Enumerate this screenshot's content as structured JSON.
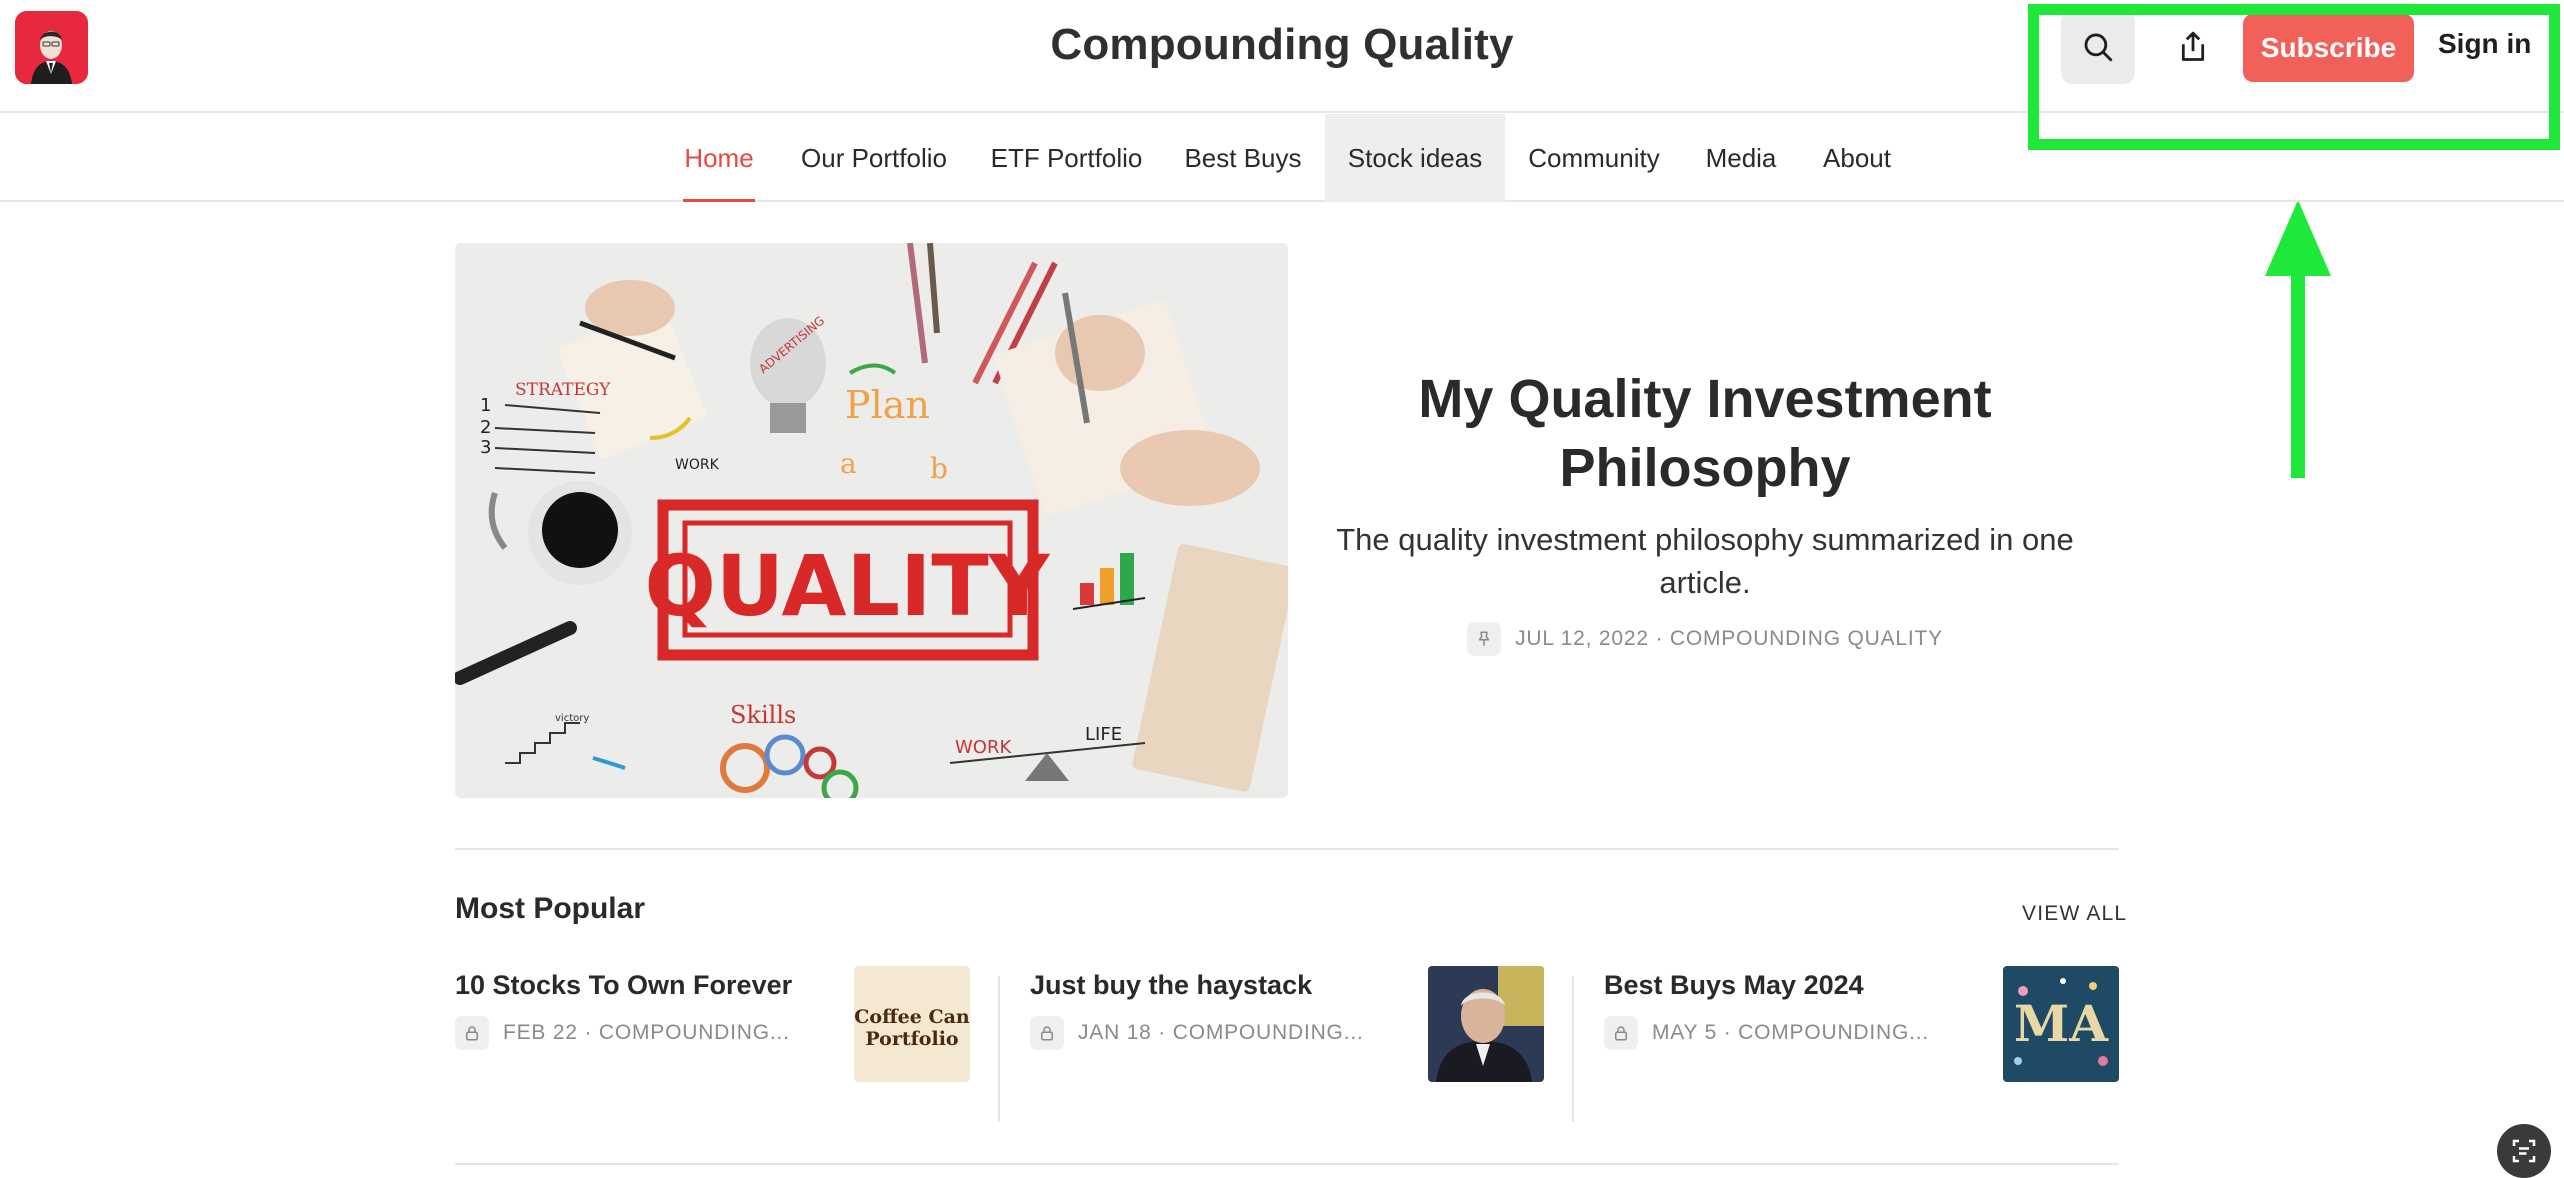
{
  "header": {
    "site_title": "Compounding Quality",
    "subscribe_label": "Subscribe",
    "signin_label": "Sign in"
  },
  "nav": {
    "items": [
      {
        "label": "Home"
      },
      {
        "label": "Our Portfolio"
      },
      {
        "label": "ETF Portfolio"
      },
      {
        "label": "Best Buys"
      },
      {
        "label": "Stock ideas"
      },
      {
        "label": "Community"
      },
      {
        "label": "Media"
      },
      {
        "label": "About"
      }
    ]
  },
  "featured": {
    "title": "My Quality Investment Philosophy",
    "subtitle": "The quality investment philosophy summarized in one article.",
    "meta": "JUL 12, 2022 · COMPOUNDING QUALITY",
    "image_words": {
      "stamp": "QUALITY",
      "strategy": "STRATEGY",
      "plan": "Plan",
      "a": "a",
      "b": "b",
      "work": "WORK",
      "skills": "Skills",
      "work2": "WORK",
      "life": "LIFE",
      "advertising": "ADVERTISING",
      "victory": "victory",
      "n1": "1",
      "n2": "2",
      "n3": "3"
    }
  },
  "most_popular": {
    "heading": "Most Popular",
    "view_all": "VIEW ALL",
    "items": [
      {
        "title": "10 Stocks To Own Forever",
        "meta": "FEB 22 · COMPOUNDING...",
        "thumb_line1": "Coffee Can",
        "thumb_line2": "Portfolio"
      },
      {
        "title": "Just buy the haystack",
        "meta": "JAN 18 · COMPOUNDING..."
      },
      {
        "title": "Best Buys May 2024",
        "meta": "MAY 5 · COMPOUNDING...",
        "thumb_text": "MA"
      }
    ]
  },
  "colors": {
    "accent": "#e8483d",
    "subscribe": "#f26159",
    "highlight": "#1ee83a"
  },
  "icons": {
    "search": "search-icon",
    "share": "share-icon",
    "pin": "pin-icon",
    "lock": "lock-icon",
    "corner": "page-tools-icon"
  }
}
